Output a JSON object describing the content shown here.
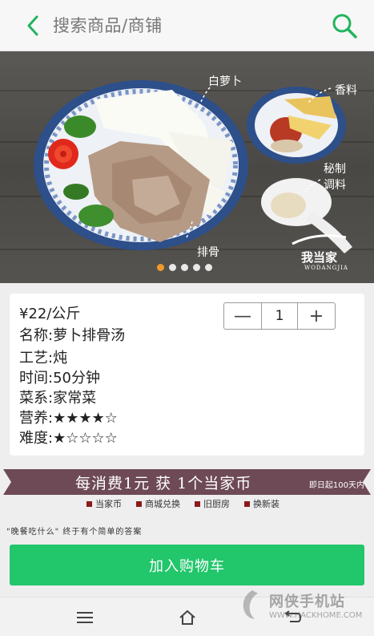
{
  "header": {
    "search_placeholder": "搜索商品/商铺"
  },
  "banner": {
    "labels": {
      "radish": "白萝卜",
      "spice": "香料",
      "sauce_line1": "秘制",
      "sauce_line2": "调料",
      "ribs": "排骨"
    },
    "brand": "我当家",
    "brand_sub": "WODANGJIA",
    "carousel_count": 5,
    "carousel_active": 0
  },
  "product": {
    "price": "¥22/公斤",
    "name": "名称:萝卜排骨汤",
    "craft": "工艺:炖",
    "time": "时间:50分钟",
    "cuisine": "菜系:家常菜",
    "nutrition": "营养:★★★★☆",
    "difficulty": "难度:★☆☆☆☆"
  },
  "quantity": {
    "minus_label": "—",
    "value": "1",
    "plus_label": "+"
  },
  "promo": {
    "main_text": "每消费1元  获  1个当家币",
    "sub_text": "即日起100天内",
    "tags": [
      "当家币",
      "商城兑换",
      "旧厨房",
      "换新装"
    ],
    "tagline": "\"晚餐吃什么\" 终于有个简单的答案"
  },
  "cart": {
    "label": "加入购物车"
  },
  "watermark": {
    "title": "网侠手机站",
    "url": "WWW.HACKHOME.COM"
  },
  "colors": {
    "accent": "#22c66b",
    "promo_bg": "#6d4a55",
    "carousel_active": "#f19a2a"
  }
}
